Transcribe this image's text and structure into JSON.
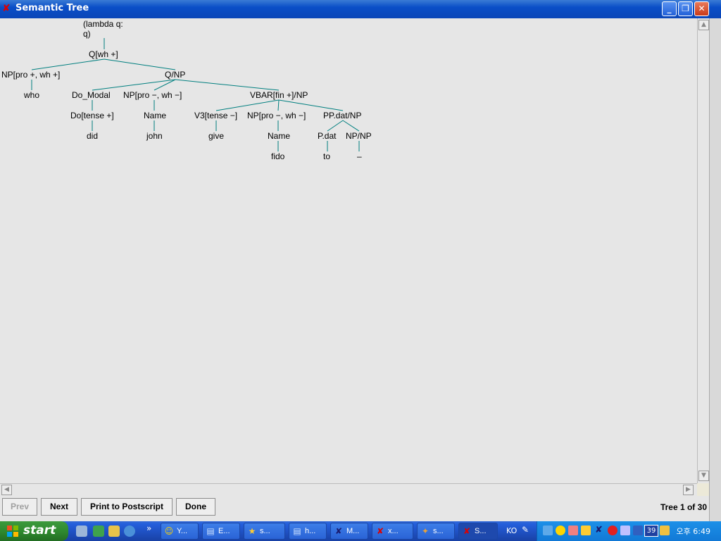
{
  "window": {
    "title": "Semantic Tree"
  },
  "tree": {
    "lambda_line1": "(lambda q:",
    "lambda_line2": "q)",
    "root": "Q[wh +]",
    "np_wh": "NP[pro +, wh +]",
    "who": "who",
    "q_np": "Q/NP",
    "do_modal": "Do_Modal",
    "do_tense": "Do[tense +]",
    "did": "did",
    "np_pro_1": "NP[pro −, wh −]",
    "name_1": "Name",
    "john": "john",
    "vbar": "VBAR[fin +]/NP",
    "v3": "V3[tense −]",
    "give": "give",
    "np_pro_2": "NP[pro −, wh −]",
    "name_2": "Name",
    "fido": "fido",
    "pp_dat": "PP.dat/NP",
    "p_dat": "P.dat",
    "to": "to",
    "np_np": "NP/NP",
    "gap": "–"
  },
  "buttons": {
    "prev": "Prev",
    "next": "Next",
    "print": "Print to Postscript",
    "done": "Done"
  },
  "status": {
    "tree_count": "Tree 1 of 30"
  },
  "taskbar": {
    "start": "start",
    "quicklaunch_more": "»",
    "tasks": [
      {
        "icon": "messenger-icon",
        "label": "Y..."
      },
      {
        "icon": "document-icon",
        "label": "E..."
      },
      {
        "icon": "runner-icon",
        "label": "s..."
      },
      {
        "icon": "document-icon",
        "label": "h..."
      },
      {
        "icon": "x-app-icon",
        "label": "M..."
      },
      {
        "icon": "x-app-icon",
        "label": "x..."
      },
      {
        "icon": "tool-icon",
        "label": "s..."
      },
      {
        "icon": "x-app-icon",
        "label": "S..."
      }
    ],
    "language": "KO",
    "clock": "오후 6:49",
    "tray_badge": "39"
  },
  "colors": {
    "edge": "#007f7f",
    "titlebar": "#0a4ec7",
    "taskbar": "#245edb"
  }
}
